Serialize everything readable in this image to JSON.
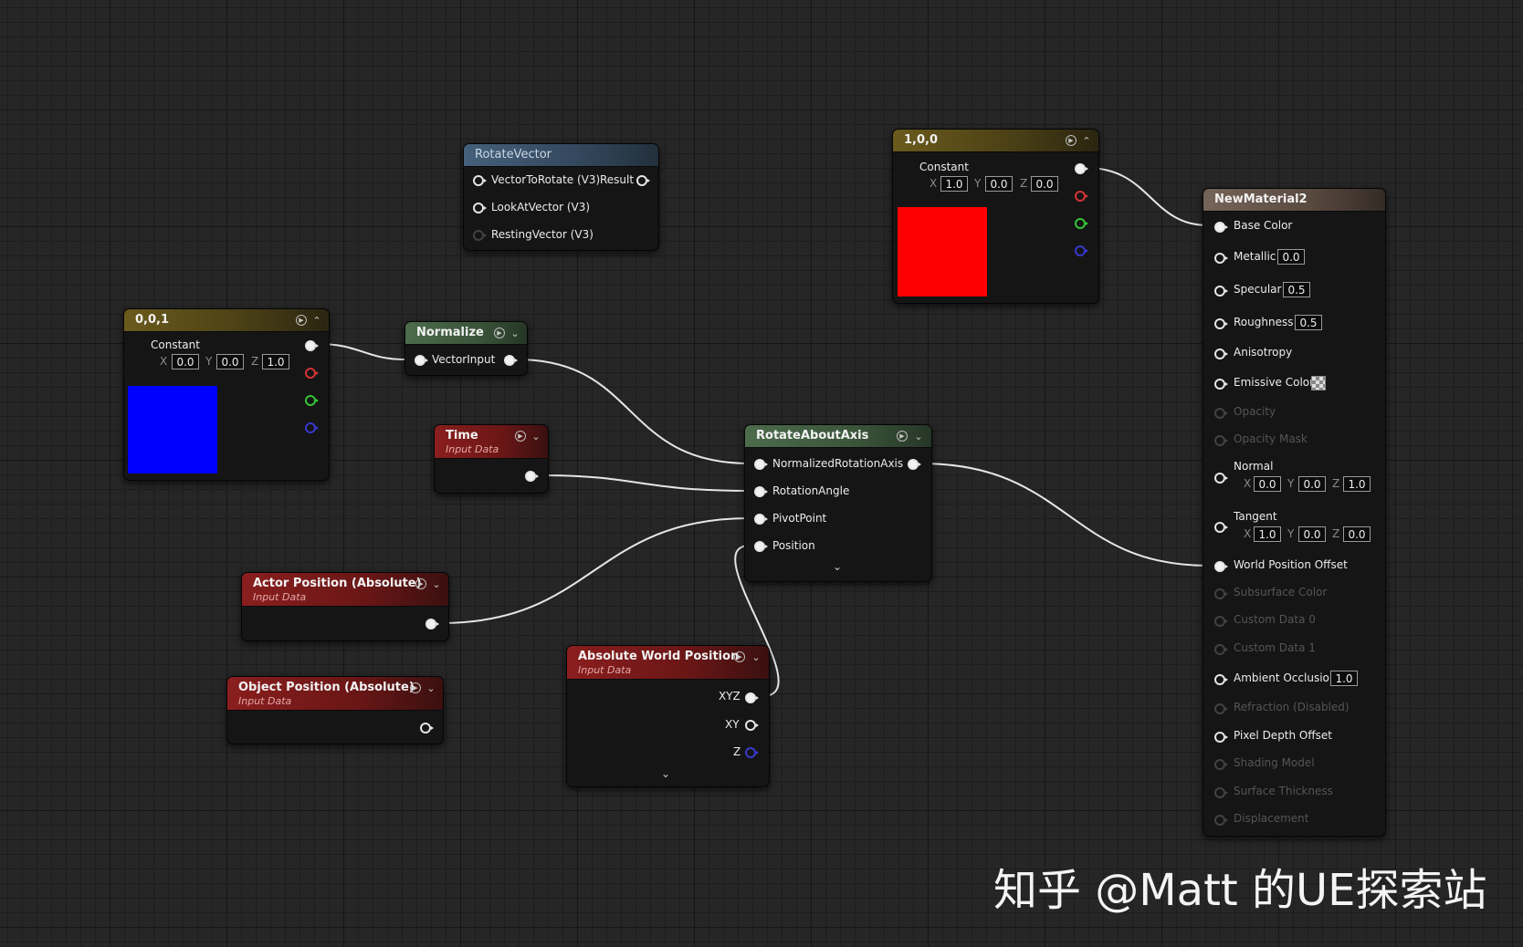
{
  "nodes": {
    "constant001": {
      "title": "0,0,1",
      "label": "Constant",
      "x": "0.0",
      "y": "0.0",
      "z": "1.0",
      "swatch": "#0000ff"
    },
    "constant100": {
      "title": "1,0,0",
      "label": "Constant",
      "x": "1.0",
      "y": "0.0",
      "z": "0.0",
      "swatch": "#ff0000"
    },
    "rotate_vector": {
      "title": "RotateVector",
      "in1": "VectorToRotate (V3)",
      "out1": "Result",
      "in2": "LookAtVector (V3)",
      "in3": "RestingVector (V3)"
    },
    "normalize": {
      "title": "Normalize",
      "in1": "VectorInput"
    },
    "time": {
      "title": "Time",
      "subtitle": "Input Data"
    },
    "rotate_about_axis": {
      "title": "RotateAboutAxis",
      "in1": "NormalizedRotationAxis",
      "in2": "RotationAngle",
      "in3": "PivotPoint",
      "in4": "Position"
    },
    "actor_position": {
      "title": "Actor Position (Absolute)",
      "subtitle": "Input Data"
    },
    "object_position": {
      "title": "Object Position  (Absolute)",
      "subtitle": "Input Data"
    },
    "absolute_world_position": {
      "title": "Absolute World Position",
      "subtitle": "Input Data",
      "out1": "XYZ",
      "out2": "XY",
      "out3": "Z"
    },
    "material": {
      "title": "NewMaterial2",
      "base_color": "Base Color",
      "metallic": "Metallic",
      "metallic_val": "0.0",
      "specular": "Specular",
      "specular_val": "0.5",
      "roughness": "Roughness",
      "roughness_val": "0.5",
      "anisotropy": "Anisotropy",
      "emissive": "Emissive Color",
      "opacity": "Opacity",
      "opacity_mask": "Opacity Mask",
      "normal": "Normal",
      "normal_x": "0.0",
      "normal_y": "0.0",
      "normal_z": "1.0",
      "tangent": "Tangent",
      "tangent_x": "1.0",
      "tangent_y": "0.0",
      "tangent_z": "0.0",
      "wpo": "World Position Offset",
      "subsurface": "Subsurface Color",
      "custom0": "Custom Data 0",
      "custom1": "Custom Data 1",
      "ao": "Ambient Occlusion",
      "ao_val": "1.0",
      "refraction": "Refraction (Disabled)",
      "pdo": "Pixel Depth Offset",
      "shading_model": "Shading Model",
      "surface_thickness": "Surface Thickness",
      "displacement": "Displacement"
    }
  },
  "axis_labels": {
    "x": "X",
    "y": "Y",
    "z": "Z"
  },
  "watermark": "知乎 @Matt 的UE探索站"
}
